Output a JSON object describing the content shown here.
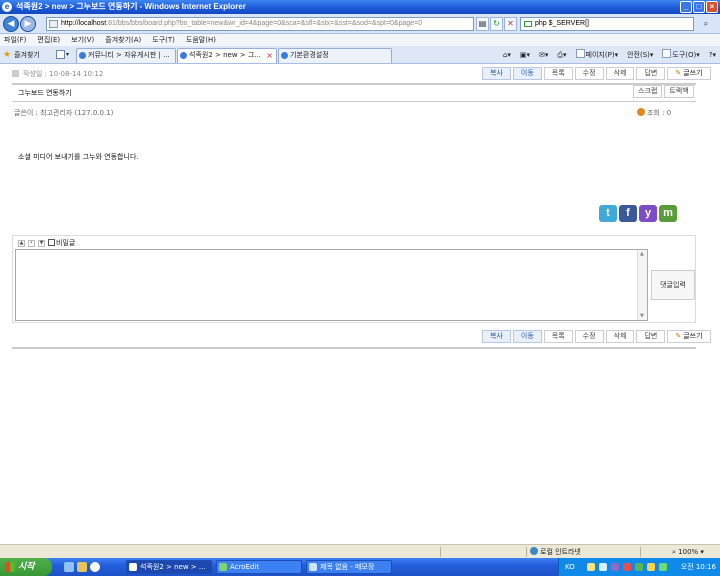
{
  "window": {
    "title": "석족원2 > new > 그누보드 연동하기 - Windows Internet Explorer"
  },
  "address_bar": {
    "url_host": "http://localhost",
    "url_rest": ":81/bbs/bbs/board.php?bo_table=new&wr_id=4&page=0&sca=&sfl=&stx=&sst=&sod=&spt=0&page=0",
    "search_value": "php $_SERVER[]"
  },
  "menu": [
    "파일(F)",
    "편집(E)",
    "보기(V)",
    "즐겨찾기(A)",
    "도구(T)",
    "도움말(H)"
  ],
  "favorites_label": "즐겨찾기",
  "tabs": [
    {
      "label": "커뮤니티 > 자유게시판 | ..."
    },
    {
      "label": "석족원2 > new > 그..."
    },
    {
      "label": "기본환경설정"
    }
  ],
  "commandbar": {
    "page": "페이지(P)",
    "safety": "안전(S)",
    "tools": "도구(O)"
  },
  "post": {
    "date": "작성일 : 10-08-14 10:12",
    "subject": "그누보드 연동하기",
    "author": "글쓴이 : 최고관리자 (127.0.0.1)",
    "views": "조회 : 0",
    "content": "소셜 미디어 보내기를 그누와 연동합니다.",
    "scrap": "스크랩",
    "trackback": "트랙백"
  },
  "buttons": {
    "copy": "복사",
    "move": "이동",
    "list": "목록",
    "edit": "수정",
    "delete": "삭제",
    "reply": "답변",
    "write": "글쓰기"
  },
  "social": [
    "twitter",
    "facebook",
    "yozm",
    "me2day"
  ],
  "comment": {
    "secret_label": "비밀글",
    "submit": "댓글입력"
  },
  "statusbar": {
    "zone": "로컬 인트라넷",
    "zoom": "100%"
  },
  "taskbar": {
    "start": "시작",
    "items": [
      "석족원2 > new > ...",
      "AcroEdit",
      "제목 없음 - 메모장"
    ],
    "ime": "KO",
    "clock": "오전 10:16"
  }
}
